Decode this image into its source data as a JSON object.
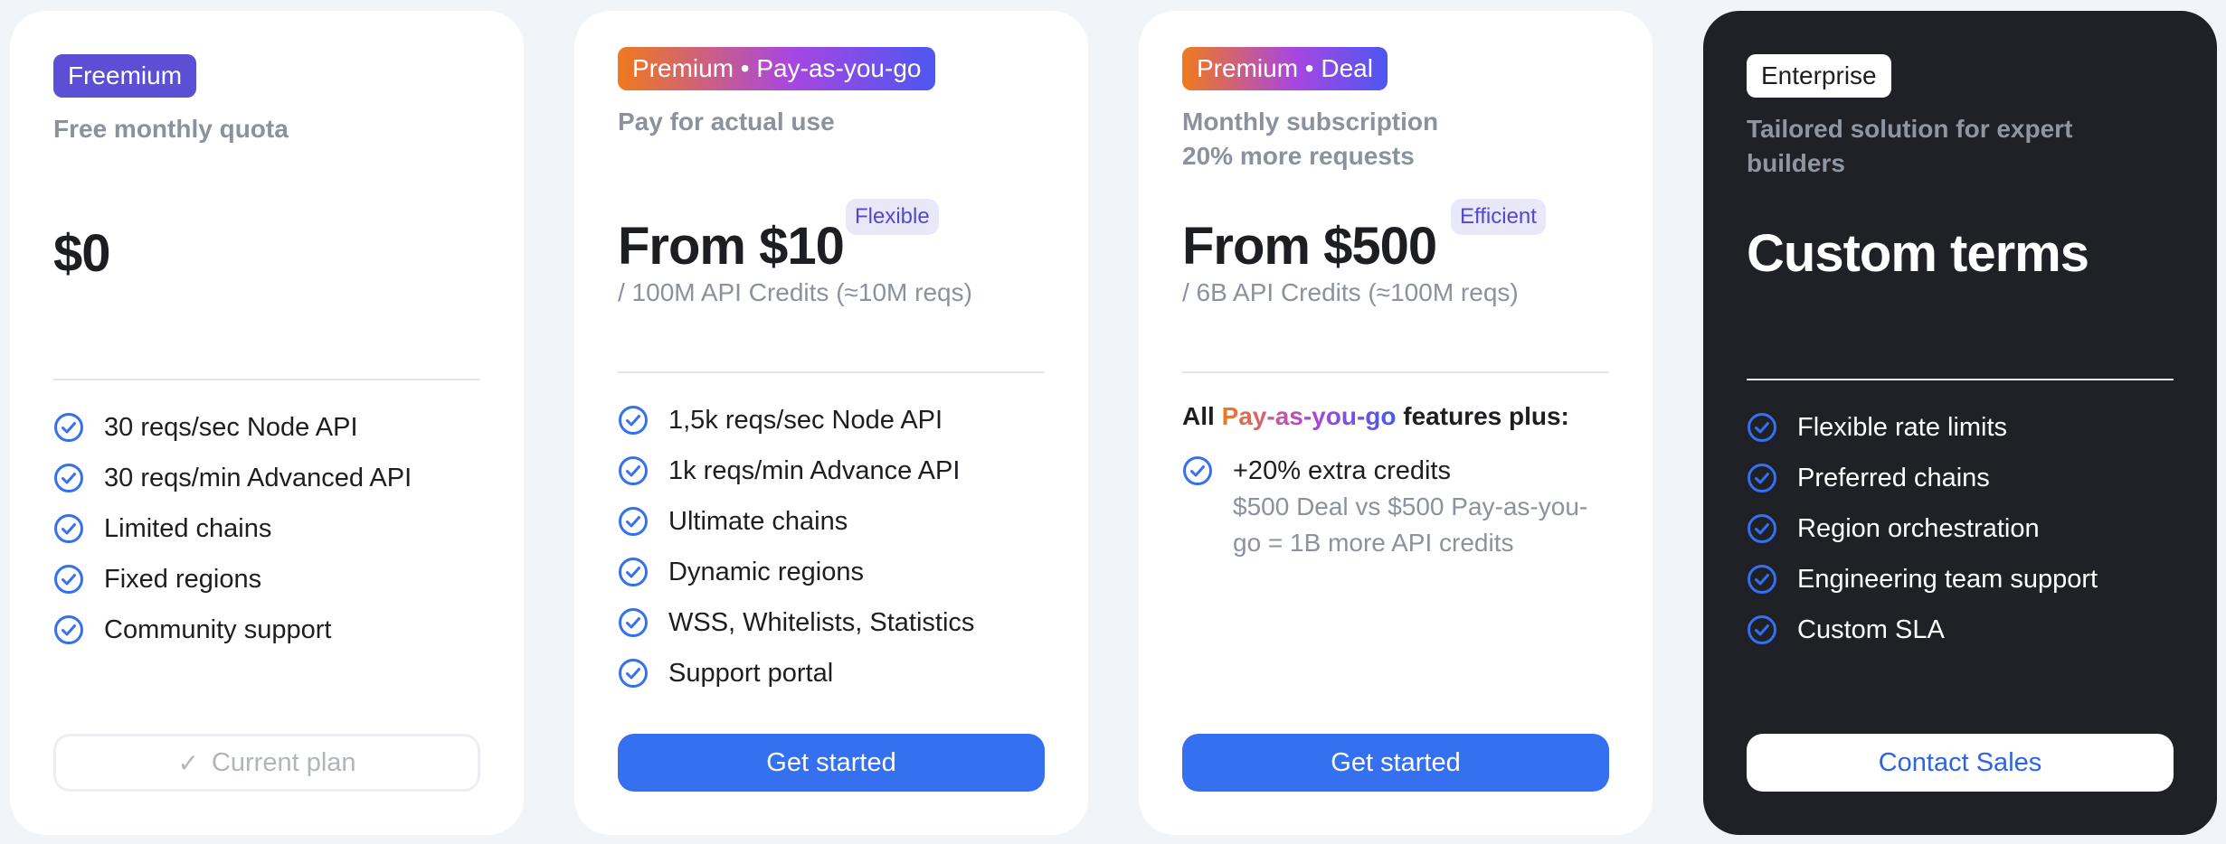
{
  "colors": {
    "page_bg": "#f1f4f9",
    "card_bg": "#ffffff",
    "dark_card_bg": "#1f2126",
    "primary_button": "#3470f0",
    "check_icon": "#3470f0",
    "badge_violet": "#5b4fd6",
    "badge_gradient_start": "#f07a1d",
    "badge_gradient_end": "#4d57f0",
    "muted_text": "#8b929e"
  },
  "plans": [
    {
      "badge": "Freemium",
      "subtitle": "Free monthly quota",
      "price": "$0",
      "features": [
        "30 reqs/sec Node API",
        "30 reqs/min Advanced API",
        "Limited chains",
        "Fixed regions",
        "Community support"
      ],
      "button": {
        "icon": "check-icon",
        "label": "Current plan"
      }
    },
    {
      "badge": "Premium • Pay-as-you-go",
      "subtitle": "Pay for actual use",
      "price": "From $10",
      "tag": "Flexible",
      "price_note": "/ 100M API Credits (≈10M reqs)",
      "features": [
        "1,5k reqs/sec Node API",
        "1k reqs/min Advance API",
        "Ultimate chains",
        "Dynamic regions",
        "WSS, Whitelists, Statistics",
        "Support portal"
      ],
      "button": {
        "label": "Get started"
      }
    },
    {
      "badge": "Premium • Deal",
      "subtitle_line1": "Monthly subscription",
      "subtitle_line2": "20% more requests",
      "price": "From $500",
      "tag": "Efficient",
      "price_note": "/ 6B API Credits (≈100M reqs)",
      "features_heading": {
        "prefix": "All",
        "highlight": "Pay-as-you-go",
        "suffix": "features plus:"
      },
      "features": [
        "+20% extra credits"
      ],
      "feature_note": "$500 Deal vs $500 Pay-as-you-go = 1B more API credits",
      "button": {
        "label": "Get started"
      }
    },
    {
      "badge": "Enterprise",
      "subtitle": "Tailored solution for expert builders",
      "price": "Custom terms",
      "features": [
        "Flexible rate limits",
        "Preferred chains",
        "Region orchestration",
        "Engineering team support",
        "Custom SLA"
      ],
      "button": {
        "label": "Contact Sales"
      }
    }
  ]
}
